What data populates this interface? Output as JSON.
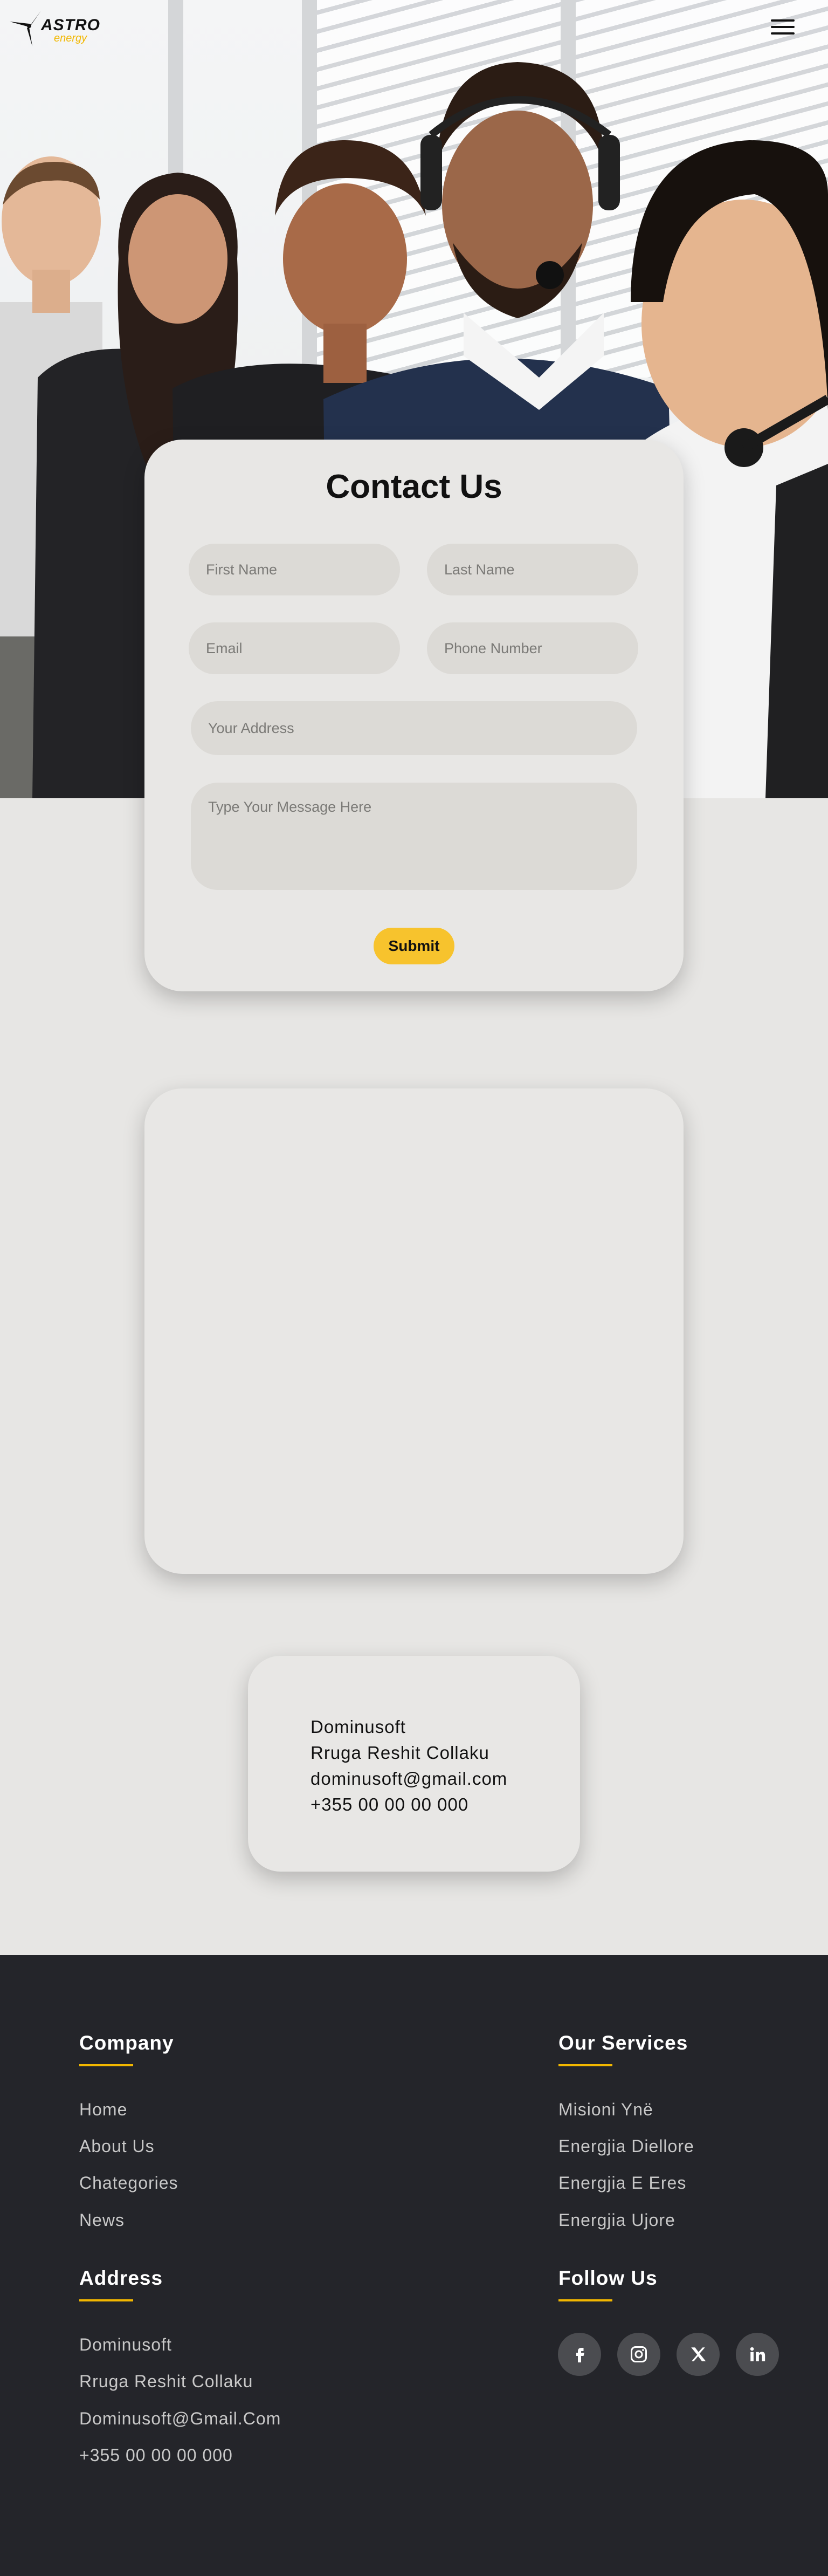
{
  "brand": {
    "logo_word": "ASTRO",
    "logo_sub": "energy",
    "accent": "#f2b700",
    "submit_color": "#f7c32d",
    "footer_bg": "#24252a",
    "page_bg": "#e7e6e4"
  },
  "nav": {
    "menu_icon": "hamburger-icon"
  },
  "contact_form": {
    "title": "Contact Us",
    "first_name_placeholder": "First Name",
    "last_name_placeholder": "Last Name",
    "email_placeholder": "Email",
    "phone_placeholder": "Phone Number",
    "address_placeholder": "Your Address",
    "message_placeholder": "Type Your Message Here",
    "submit_label": "Submit"
  },
  "contact_info": {
    "company": "Dominusoft",
    "street": "Rruga Reshit Collaku",
    "email": "dominusoft@gmail.com",
    "phone": "+355 00 00 00 000"
  },
  "footer": {
    "company": {
      "heading": "Company",
      "links": [
        "Home",
        "About Us",
        "Chategories",
        "News"
      ]
    },
    "services": {
      "heading": "Our Services",
      "links": [
        "Misioni Ynë",
        "Energjia Diellore",
        "Energjia E Eres",
        "Energjia Ujore"
      ]
    },
    "address": {
      "heading": "Address",
      "lines": [
        "Dominusoft",
        "Rruga Reshit Collaku",
        "Dominusoft@Gmail.Com",
        "+355 00 00 00 000"
      ]
    },
    "follow": {
      "heading": "Follow Us",
      "icons": [
        "facebook-icon",
        "instagram-icon",
        "x-twitter-icon",
        "linkedin-icon"
      ]
    }
  }
}
